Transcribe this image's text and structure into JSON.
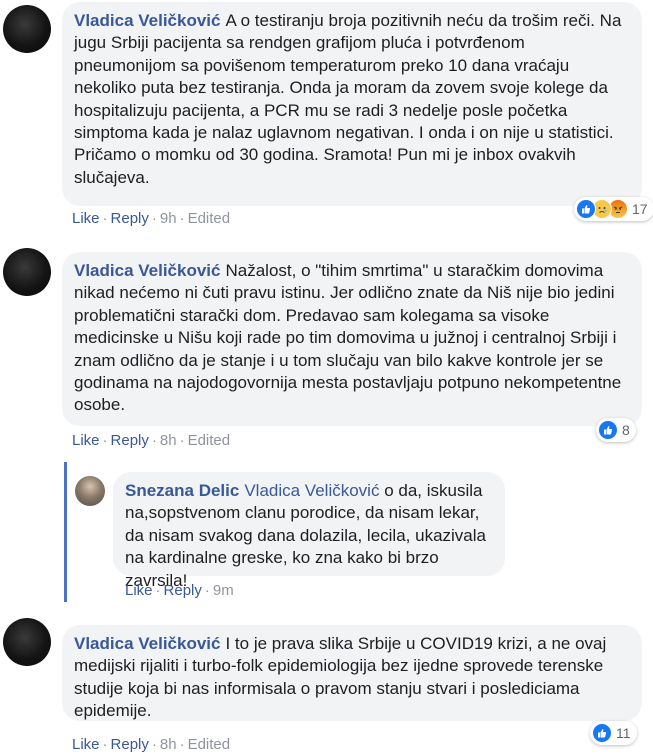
{
  "comments": [
    {
      "author": "Vladica Veličković",
      "text": "A o testiranju broja pozitivnih neću da trošim reči. Na jugu Srbiji pacijenta sa rendgen grafijom pluća i potvrđenom pneumonijom sa povišenom temperaturom preko 10 dana vraćaju nekoliko puta bez testiranja. Onda ja moram da zovem svoje kolege da hospitalizuju pacijenta, a PCR mu se radi 3 nedelje posle početka simptoma kada je nalaz uglavnom negativan. I onda i on nije u statistici. Pričamo o momku od 30 godina. Sramota! Pun mi je inbox ovakvih slučajeva.",
      "like_label": "Like",
      "reply_label": "Reply",
      "time": "9h",
      "edited": "Edited",
      "reaction_count": "17",
      "reactions": [
        "like-icon",
        "sad-icon",
        "angry-icon"
      ]
    },
    {
      "author": "Vladica Veličković",
      "text": "Nažalost, o \"tihim smrtima\" u staračkim domovima nikad nećemo ni čuti pravu istinu. Jer odlično znate da Niš nije bio jedini problematični starački dom. Predavao sam kolegama sa visoke medicinske u Nišu koji rade po tim domovima u južnoj i centralnoj Srbiji i znam odlično da je stanje i u tom slučaju van bilo kakve kontrole jer se godinama na najodogovornija mesta postavljaju potpuno nekompetentne osobe.",
      "like_label": "Like",
      "reply_label": "Reply",
      "time": "8h",
      "edited": "Edited",
      "reaction_count": "8",
      "reactions": [
        "like-icon"
      ]
    },
    {
      "author": "Vladica Veličković",
      "text": "I to je prava slika Srbije u COVID19 krizi, a ne ovaj medijski rijaliti i turbo-folk epidemiologija bez ijedne sprovede terenske studije koja bi nas informisala o pravom stanju stvari i poslediciama epidemije.",
      "like_label": "Like",
      "reply_label": "Reply",
      "time": "8h",
      "edited": "Edited",
      "reaction_count": "11",
      "reactions": [
        "like-icon"
      ]
    }
  ],
  "reply": {
    "author": "Snezana Delic",
    "mention": "Vladica Veličković",
    "text": "o da, iskusila na,sopstvenom clanu porodice, da nisam lekar, da nisam svakog dana dolazila, lecila, ukazivala na kardinalne greske, ko zna kako bi brzo zavrsila!",
    "like_label": "Like",
    "reply_label": "Reply",
    "time": "9m"
  },
  "colors": {
    "link": "#385898",
    "bubble": "#f2f3f5",
    "thread_line": "#4b72c7",
    "like_blue": "#1877f2"
  }
}
